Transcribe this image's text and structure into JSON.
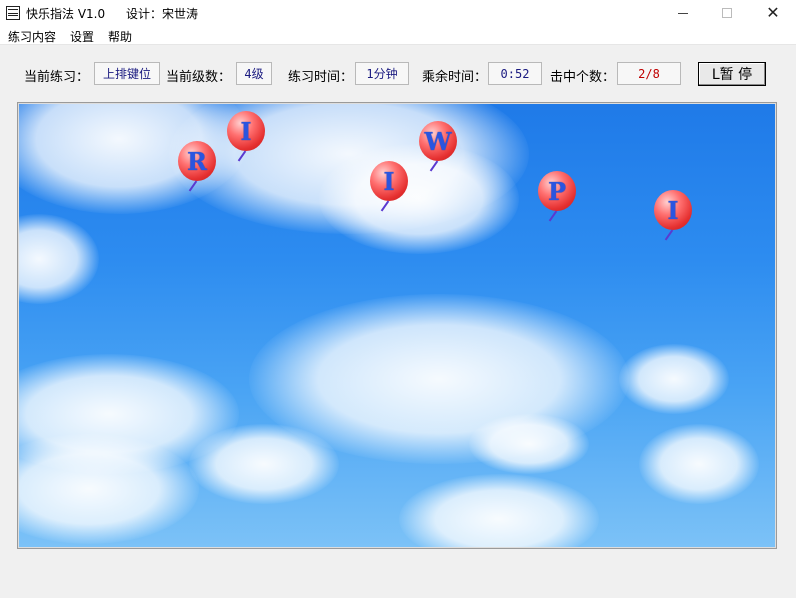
{
  "window": {
    "title": "快乐指法 V1.0",
    "designer": "设计：宋世涛",
    "min_glyph": "",
    "max_glyph": "",
    "close_glyph": "✕"
  },
  "menu": {
    "items": [
      "练习内容",
      "设置",
      "帮助"
    ]
  },
  "info": {
    "current_practice_label": "当前练习：",
    "current_practice_value": "上排键位",
    "level_label": "当前级数：",
    "level_value": "4级",
    "practice_time_label": "练习时间：",
    "practice_time_value": "1分钟",
    "remaining_label": "乘余时间：",
    "remaining_value": "0:52",
    "hits_label": "击中个数：",
    "hits_value": "2/8",
    "pause_label": "L暂  停"
  },
  "game": {
    "balloons": [
      "R",
      "I",
      "I",
      "W",
      "P",
      "I"
    ]
  }
}
